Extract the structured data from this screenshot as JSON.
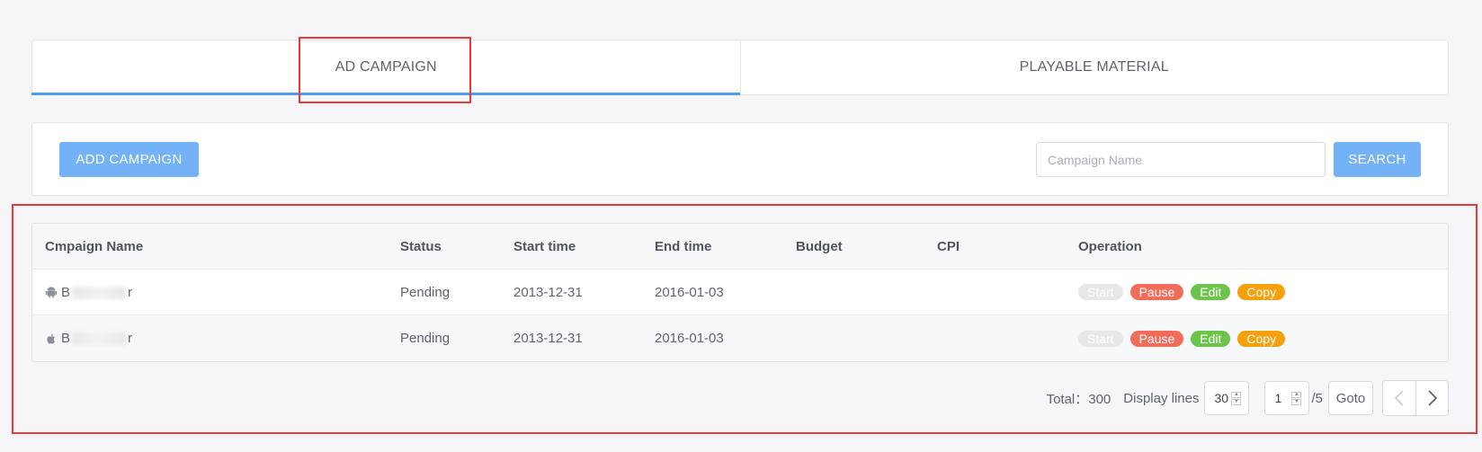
{
  "tabs": [
    {
      "label": "AD CAMPAIGN",
      "active": true
    },
    {
      "label": "PLAYABLE MATERIAL",
      "active": false
    }
  ],
  "toolbar": {
    "add_label": "ADD CAMPAIGN",
    "search_placeholder": "Campaign Name",
    "search_value": "",
    "search_label": "SEARCH"
  },
  "table": {
    "headers": [
      "Cmpaign Name",
      "Status",
      "Start time",
      "End time",
      "Budget",
      "CPI",
      "Operation"
    ],
    "rows": [
      {
        "platform": "android-icon",
        "name_start": "B",
        "name_end": "r",
        "status": "Pending",
        "start": "2013-12-31",
        "end": "2016-01-03",
        "budget": "",
        "cpi": ""
      },
      {
        "platform": "apple-icon",
        "name_start": "B",
        "name_end": "r",
        "status": "Pending",
        "start": "2013-12-31",
        "end": "2016-01-03",
        "budget": "",
        "cpi": ""
      }
    ],
    "operations": {
      "start": "Start",
      "pause": "Pause",
      "edit": "Edit",
      "copy": "Copy"
    }
  },
  "pagination": {
    "total_text": "Total：300",
    "lines_label": "Display lines",
    "lines_value": "30",
    "page_value": "1",
    "page_count": "/5",
    "goto_label": "Goto"
  },
  "colors": {
    "accent": "#4d9cf0",
    "primary_button": "#74b2f7",
    "pause": "#f36c5a",
    "edit": "#6cc44b",
    "copy": "#f5a00d",
    "highlight": "#e63a3a"
  }
}
